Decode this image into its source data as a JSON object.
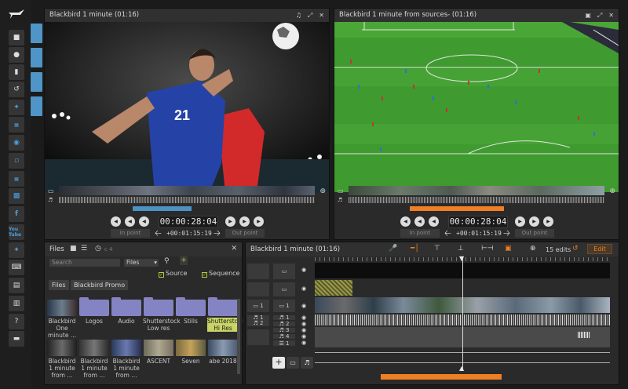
{
  "app": {
    "accent_blue": "#4d91c3",
    "accent_orange": "#ef7f25"
  },
  "rail": {
    "icons": [
      "bird-logo-icon",
      "folder-icon",
      "upload-icon",
      "trash-icon",
      "history-icon",
      "twitter-icon",
      "archive-icon",
      "globe-icon",
      "file-icon",
      "archive-icon",
      "film-icon",
      "facebook-icon",
      "youtube-icon",
      "twitter-icon",
      "keyboard-icon",
      "storage-icon",
      "stats-icon",
      "help-icon",
      "chat-icon"
    ],
    "youtube_text": "You Tube"
  },
  "source_viewer": {
    "title": "Blackbird 1 minute (01:16)",
    "timecode": "00:00:28:04",
    "duration": "+00:01:15:19",
    "in_label": "In point",
    "out_label": "Out point"
  },
  "program_viewer": {
    "title": "Blackbird 1 minute from sources",
    "title_suffix": "- (01:16)",
    "timecode": "00:00:28:04",
    "duration": "+00:01:15:19",
    "in_label": "In point",
    "out_label": "Out point"
  },
  "files": {
    "title": "Files",
    "history_suffix": "c 4",
    "search_placeholder": "Search",
    "scope_select": "Files",
    "source_check": "Source",
    "sequence_check": "Sequence",
    "breadcrumb": [
      "Files",
      "Blackbird Promo"
    ],
    "row1": [
      {
        "label": "Blackbird One minute ...",
        "kind": "clip"
      },
      {
        "label": "Logos",
        "kind": "folder"
      },
      {
        "label": "Audio",
        "kind": "folder"
      },
      {
        "label": "Shutterstock Low res",
        "kind": "folder"
      },
      {
        "label": "Stills",
        "kind": "folder"
      },
      {
        "label": "Shutterstock Hi Res",
        "kind": "folder",
        "selected": true
      }
    ],
    "row2": [
      {
        "label": "Blackbird 1 minute from ...",
        "kind": "clip"
      },
      {
        "label": "Blackbird 1 minute from ...",
        "kind": "clip"
      },
      {
        "label": "Blackbird 1 minute from ...",
        "kind": "clip"
      },
      {
        "label": "ASCENT",
        "kind": "clip"
      },
      {
        "label": "Seven",
        "kind": "clip"
      },
      {
        "label": "abe 2018",
        "kind": "clip"
      }
    ]
  },
  "timeline": {
    "title": "Blackbird 1 minute (01:16)",
    "edits": "15 edits",
    "edit_button": "Edit",
    "video_track": "1",
    "audio_tracks": [
      "1",
      "2",
      "3",
      "4"
    ],
    "track_a1": "1",
    "track_a2": "2",
    "track_bottom": "1"
  }
}
